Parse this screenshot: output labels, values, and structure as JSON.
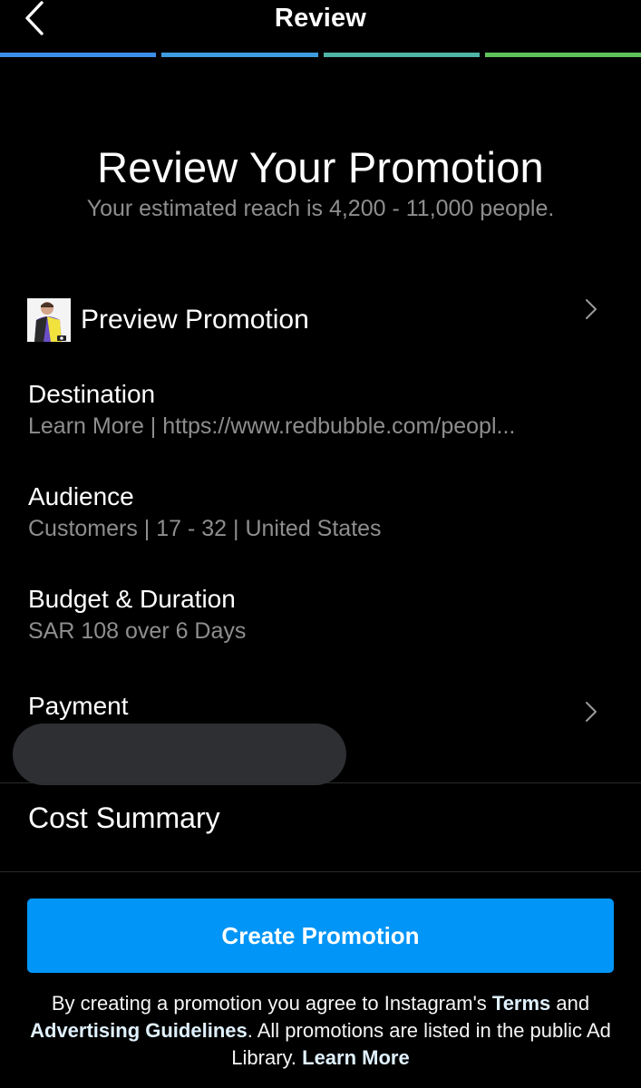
{
  "header": {
    "title": "Review",
    "back_icon": "chevron-left-icon"
  },
  "progress": {
    "steps": 4,
    "completed": 4,
    "colors": [
      "#3b8fe8",
      "#3f9be0",
      "#4fb3a6",
      "#5fc35c"
    ]
  },
  "intro": {
    "title": "Review Your Promotion",
    "reach": "Your estimated reach is 4,200 - 11,000 people."
  },
  "rows": {
    "preview": {
      "label": "Preview Promotion",
      "icon": "chevron-right-icon"
    },
    "destination": {
      "label": "Destination",
      "value": "Learn More | https://www.redbubble.com/peopl..."
    },
    "audience": {
      "label": "Audience",
      "value": "Customers | 17 - 32 | United States"
    },
    "budget": {
      "label": "Budget & Duration",
      "value": "SAR 108 over 6 Days"
    },
    "payment": {
      "label": "Payment",
      "icon": "chevron-right-icon"
    }
  },
  "cost_summary": {
    "label": "Cost Summary"
  },
  "cta": {
    "label": "Create Promotion",
    "color": "#0095f6"
  },
  "legal": {
    "part1": "By creating a promotion you agree to Instagram's ",
    "terms": "Terms",
    "part2": " and ",
    "guidelines": "Advertising Guidelines",
    "part3": ". All promotions are listed in the public Ad Library. ",
    "learn_more": "Learn More"
  }
}
